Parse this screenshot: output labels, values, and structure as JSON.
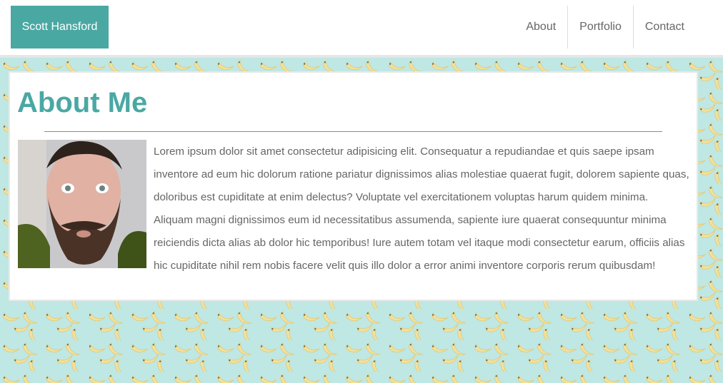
{
  "nav": {
    "brand": "Scott Hansford",
    "links": [
      "About",
      "Portfolio",
      "Contact"
    ]
  },
  "about": {
    "title": "About Me",
    "body": "Lorem ipsum dolor sit amet consectetur adipisicing elit. Consequatur a repudiandae et quis saepe ipsam inventore ad eum hic dolorum ratione pariatur dignissimos alias molestiae quaerat fugit, dolorem sapiente quas, doloribus est cupiditate at enim delectus? Voluptate vel exercitationem voluptas harum quidem minima. Aliquam magni dignissimos eum id necessitatibus assumenda, sapiente iure quaerat consequuntur minima reiciendis dicta alias ab dolor hic temporibus! Iure autem totam vel itaque modi consectetur earum, officiis alias hic cupiditate nihil rem nobis facere velit quis illo dolor a error animi inventore corporis rerum quibusdam!"
  },
  "colors": {
    "accent": "#4aa8a3",
    "background_pattern": "#bfe7e3",
    "banana": "#f3e19a"
  },
  "icons": {
    "background": "banana-pattern",
    "photo": "profile-photo"
  }
}
